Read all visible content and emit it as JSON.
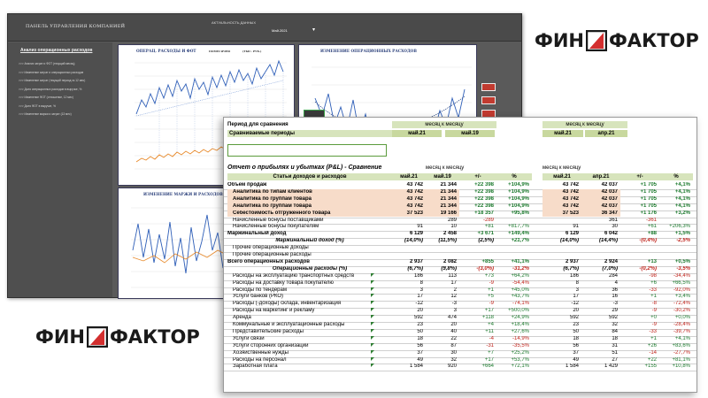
{
  "dashboard": {
    "title": "ПАНЕЛЬ УПРАВЛЕНИЯ КОМПАНИЕЙ",
    "field_label": "АКТУАЛЬНОСТЬ ДАННЫХ",
    "period_value": "Май.2021",
    "sidebar_heading": "Анализ операционных расходов",
    "sidebar_items": [
      ">>> Анализ затрат и ФОТ (текущий месяц)",
      ">>> Изменение затрат и операционных расходов",
      ">>> Изменение затрат (текущий период vs 12 мес)",
      ">>> Доля операционных расходов в выручке, %",
      ">>> Изменение ФОТ (отношение, 12 мес)",
      ">>> Доля ФОТ в выручке, %",
      ">>> Изменение маржи и затрат (13 мес)"
    ],
    "panels": {
      "p1_title": "ОПЕРАЦ. РАСХОДЫ И ФОТ",
      "p1_legend": "ПОМЕСЯЧНО",
      "p1_legend2": "(ТЫС. РУБ.)",
      "p2_title": "ИЗМЕНЕНИЕ ОПЕРАЦИОННЫХ РАСХОДОВ",
      "p3_title": "ИЗМЕНЕНИЕ МАРЖИ И РАСХОДОВ"
    }
  },
  "logos": {
    "left_part": "ФИН",
    "right_part": "ФАКТОР"
  },
  "colors": {
    "logo_red": "#d32f2f",
    "header_green": "#d7e4bc",
    "pink_row": "#f7dcc9",
    "positive": "#1c7a2e",
    "negative": "#c0251d"
  },
  "sheet": {
    "period_label": "Период для сравнения",
    "period_value": "месяц к месяцу",
    "period_value_right": "месяц к месяцу",
    "compared_label": "Сравниваемые периоды",
    "p1": "май.21",
    "p2": "май.19",
    "p3": "май.21",
    "p4": "апр.21",
    "report_title": "Отчет о прибылях и убытках (P&L) - Сравнение",
    "report_mode": "месяц к месяцу",
    "report_mode_right": "месяц к месяцу",
    "col_item": "Статьи доходов и расходов",
    "col_pm": "+/-",
    "col_pct": "%",
    "rows": [
      {
        "name": "Объем продаж",
        "a": "43 742",
        "b": "21 344",
        "d": "+22 398",
        "p": "+104,9%",
        "c": "43 742",
        "e": "42 037",
        "d2": "+1 705",
        "p2": "+4,1%"
      },
      {
        "name": "Аналитика по типам клиентов",
        "a": "43 742",
        "b": "21 344",
        "d": "+22 398",
        "p": "+104,9%",
        "c": "43 742",
        "e": "42 037",
        "d2": "+1 705",
        "p2": "+4,1%"
      },
      {
        "name": "Аналитика по группам товара",
        "a": "43 742",
        "b": "21 344",
        "d": "+22 398",
        "p": "+104,9%",
        "c": "43 742",
        "e": "42 037",
        "d2": "+1 705",
        "p2": "+4,1%"
      },
      {
        "name": "Аналитика по группам товара",
        "a": "43 742",
        "b": "21 344",
        "d": "+22 398",
        "p": "+104,9%",
        "c": "43 742",
        "e": "42 037",
        "d2": "+1 705",
        "p2": "+4,1%"
      },
      {
        "name": "Себестоимость отгруженного товара",
        "a": "37 523",
        "b": "19 166",
        "d": "+18 357",
        "p": "+95,8%",
        "c": "37 523",
        "e": "36 347",
        "d2": "+1 176",
        "p2": "+3,2%"
      },
      {
        "name": "Начисленные бонусы поставщиками",
        "a": "",
        "b": "289",
        "d": "-289",
        "p": "",
        "c": "",
        "e": "361",
        "d2": "-361",
        "p2": ""
      },
      {
        "name": "Начисленные бонусы покупателям",
        "a": "91",
        "b": "10",
        "d": "+81",
        "p": "+817,7%",
        "c": "91",
        "e": "30",
        "d2": "+61",
        "p2": "+206,3%"
      },
      {
        "name": "Маржинальный доход",
        "a": "6 129",
        "b": "2 458",
        "d": "+3 671",
        "p": "+149,4%",
        "c": "6 129",
        "e": "6 042",
        "d2": "+88",
        "p2": "+1,5%"
      },
      {
        "name": "Маржинальный доход (%)",
        "a": "(14,0%)",
        "b": "(11,5%)",
        "d": "(2,5%)",
        "p": "+21,7%",
        "c": "(14,0%)",
        "e": "(14,4%)",
        "d2": "-(0,4%)",
        "p2": "-2,5%"
      },
      {
        "name": "Прочие операционные доходы",
        "a": "",
        "b": "",
        "d": "",
        "p": "",
        "c": "",
        "e": "",
        "d2": "",
        "p2": ""
      },
      {
        "name": "Прочие операционные расходы",
        "a": "",
        "b": "",
        "d": "",
        "p": "",
        "c": "",
        "e": "",
        "d2": "",
        "p2": ""
      },
      {
        "name": "Всего операционных расходов",
        "a": "2 937",
        "b": "2 082",
        "d": "+855",
        "p": "+41,1%",
        "c": "2 937",
        "e": "2 924",
        "d2": "+13",
        "p2": "+0,5%"
      },
      {
        "name": "Операционные расходы (%)",
        "a": "(6,7%)",
        "b": "(9,8%)",
        "d": "-(3,0%)",
        "p": "-31,2%",
        "c": "(6,7%)",
        "e": "(7,0%)",
        "d2": "-(0,2%)",
        "p2": "-3,5%"
      },
      {
        "name": "Расходы на эксплуатацию транспортных средств",
        "a": "186",
        "b": "113",
        "d": "+73",
        "p": "+64,2%",
        "c": "186",
        "e": "284",
        "d2": "-98",
        "p2": "-34,4%"
      },
      {
        "name": "Расходы на доставку товара покупателю",
        "a": "8",
        "b": "17",
        "d": "-9",
        "p": "-54,4%",
        "c": "8",
        "e": "4",
        "d2": "+6",
        "p2": "+66,5%"
      },
      {
        "name": "Расходы по тендерам",
        "a": "3",
        "b": "2",
        "d": "+1",
        "p": "+45,0%",
        "c": "3",
        "e": "36",
        "d2": "-33",
        "p2": "-92,0%"
      },
      {
        "name": "Услуги банков (РКО)",
        "a": "17",
        "b": "12",
        "d": "+5",
        "p": "+43,7%",
        "c": "17",
        "e": "16",
        "d2": "+1",
        "p2": "+3,4%"
      },
      {
        "name": "Расходы (-доходы) склада, инвентаризация",
        "a": "-12",
        "b": "-3",
        "d": "-9",
        "p": "-74,1%",
        "c": "-12",
        "e": "-3",
        "d2": "-8",
        "p2": "-72,4%"
      },
      {
        "name": "Расходы на маркетинг и рекламу",
        "a": "20",
        "b": "3",
        "d": "+17",
        "p": "+500,0%",
        "c": "20",
        "e": "29",
        "d2": "-9",
        "p2": "-30,2%"
      },
      {
        "name": "Аренда",
        "a": "592",
        "b": "474",
        "d": "+118",
        "p": "+24,9%",
        "c": "592",
        "e": "592",
        "d2": "+0",
        "p2": "+0,0%"
      },
      {
        "name": "Коммунальные и эксплуатационные расходы",
        "a": "23",
        "b": "20",
        "d": "+4",
        "p": "+18,4%",
        "c": "23",
        "e": "32",
        "d2": "-9",
        "p2": "-28,4%"
      },
      {
        "name": "Представительские расходы",
        "a": "50",
        "b": "40",
        "d": "+11",
        "p": "+27,6%",
        "c": "50",
        "e": "84",
        "d2": "-33",
        "p2": "-39,7%"
      },
      {
        "name": "Услуги связи",
        "a": "18",
        "b": "22",
        "d": "-4",
        "p": "-14,9%",
        "c": "18",
        "e": "18",
        "d2": "+1",
        "p2": "+4,1%"
      },
      {
        "name": "Услуги сторонних организаций",
        "a": "56",
        "b": "87",
        "d": "-31",
        "p": "-35,5%",
        "c": "56",
        "e": "31",
        "d2": "+26",
        "p2": "+83,6%"
      },
      {
        "name": "Хозяйственные нужды",
        "a": "37",
        "b": "30",
        "d": "+7",
        "p": "+25,2%",
        "c": "37",
        "e": "51",
        "d2": "-14",
        "p2": "-27,7%"
      },
      {
        "name": "Расходы на персонал",
        "a": "49",
        "b": "32",
        "d": "+17",
        "p": "+53,7%",
        "c": "49",
        "e": "27",
        "d2": "+22",
        "p2": "+81,1%"
      },
      {
        "name": "Заработная плата",
        "a": "1 584",
        "b": "920",
        "d": "+664",
        "p": "+72,1%",
        "c": "1 584",
        "e": "1 429",
        "d2": "+155",
        "p2": "+10,8%"
      }
    ]
  }
}
